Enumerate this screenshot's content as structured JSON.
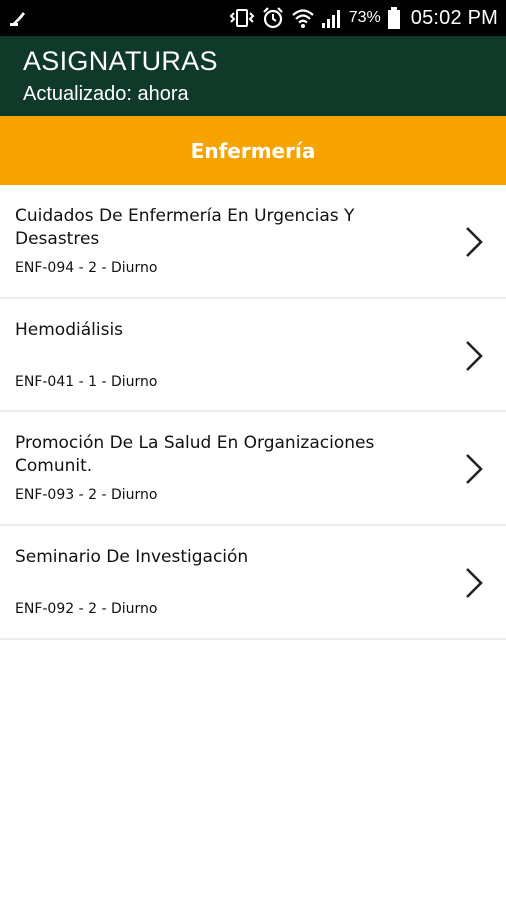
{
  "status_bar": {
    "battery_percent": "73%",
    "time": "05:02 PM",
    "icons": [
      "notification-broom-icon",
      "vibrate-icon",
      "alarm-icon",
      "wifi-icon",
      "signal-icon",
      "battery-icon"
    ]
  },
  "header": {
    "title": "ASIGNATURAS",
    "subtitle": "Actualizado: ahora"
  },
  "section": {
    "title": "Enfermería"
  },
  "courses": [
    {
      "name": "Cuidados De Enfermería En Urgencias Y Desastres",
      "code": "ENF-094 - 2 - Diurno"
    },
    {
      "name": "Hemodiálisis",
      "code": "ENF-041 - 1 - Diurno"
    },
    {
      "name": "Promoción De La Salud En Organizaciones Comunit.",
      "code": "ENF-093 - 2 - Diurno"
    },
    {
      "name": "Seminario De Investigación",
      "code": "ENF-092 - 2 - Diurno"
    }
  ],
  "colors": {
    "header_bg": "#0f3a2a",
    "section_bg": "#f8a400",
    "status_bg": "#000000"
  }
}
